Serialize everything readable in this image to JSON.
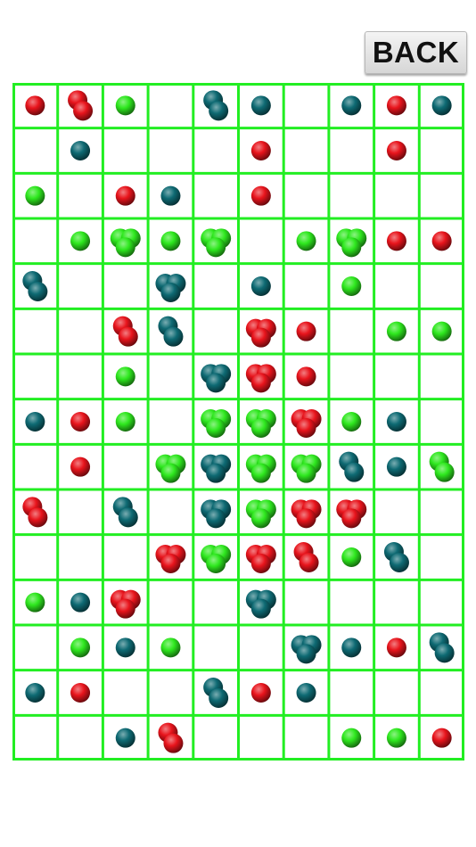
{
  "header": {
    "back_label": "BACK"
  },
  "colors": {
    "grid_line": "#22ee22",
    "red": "#e8141c",
    "green": "#2ee81e",
    "teal": "#0e6a73"
  },
  "board": {
    "rows": 15,
    "cols": 10,
    "cells": [
      [
        {
          "c": "red",
          "n": 1
        },
        {
          "c": "red",
          "n": 2
        },
        {
          "c": "green",
          "n": 1
        },
        null,
        {
          "c": "teal",
          "n": 2
        },
        {
          "c": "teal",
          "n": 1
        },
        null,
        {
          "c": "teal",
          "n": 1
        },
        {
          "c": "red",
          "n": 1
        },
        {
          "c": "teal",
          "n": 1
        }
      ],
      [
        null,
        {
          "c": "teal",
          "n": 1
        },
        null,
        null,
        null,
        {
          "c": "red",
          "n": 1
        },
        null,
        null,
        {
          "c": "red",
          "n": 1
        },
        null
      ],
      [
        {
          "c": "green",
          "n": 1
        },
        null,
        {
          "c": "red",
          "n": 1
        },
        {
          "c": "teal",
          "n": 1
        },
        null,
        {
          "c": "red",
          "n": 1
        },
        null,
        null,
        null,
        null
      ],
      [
        null,
        {
          "c": "green",
          "n": 1
        },
        {
          "c": "green",
          "n": 3
        },
        {
          "c": "green",
          "n": 1
        },
        {
          "c": "green",
          "n": 3
        },
        null,
        {
          "c": "green",
          "n": 1
        },
        {
          "c": "green",
          "n": 3
        },
        {
          "c": "red",
          "n": 1
        },
        {
          "c": "red",
          "n": 1
        }
      ],
      [
        {
          "c": "teal",
          "n": 2
        },
        null,
        null,
        {
          "c": "teal",
          "n": 3
        },
        null,
        {
          "c": "teal",
          "n": 1
        },
        null,
        {
          "c": "green",
          "n": 1
        },
        null,
        null
      ],
      [
        null,
        null,
        {
          "c": "red",
          "n": 2
        },
        {
          "c": "teal",
          "n": 2
        },
        null,
        {
          "c": "red",
          "n": 3
        },
        {
          "c": "red",
          "n": 1
        },
        null,
        {
          "c": "green",
          "n": 1
        },
        {
          "c": "green",
          "n": 1
        }
      ],
      [
        null,
        null,
        {
          "c": "green",
          "n": 1
        },
        null,
        {
          "c": "teal",
          "n": 3
        },
        {
          "c": "red",
          "n": 3
        },
        {
          "c": "red",
          "n": 1
        },
        null,
        null,
        null
      ],
      [
        {
          "c": "teal",
          "n": 1
        },
        {
          "c": "red",
          "n": 1
        },
        {
          "c": "green",
          "n": 1
        },
        null,
        {
          "c": "green",
          "n": 3
        },
        {
          "c": "green",
          "n": 3
        },
        {
          "c": "red",
          "n": 3
        },
        {
          "c": "green",
          "n": 1
        },
        {
          "c": "teal",
          "n": 1
        },
        null
      ],
      [
        null,
        {
          "c": "red",
          "n": 1
        },
        null,
        {
          "c": "green",
          "n": 3
        },
        {
          "c": "teal",
          "n": 3
        },
        {
          "c": "green",
          "n": 3
        },
        {
          "c": "green",
          "n": 3
        },
        {
          "c": "teal",
          "n": 2
        },
        {
          "c": "teal",
          "n": 1
        },
        {
          "c": "green",
          "n": 2
        }
      ],
      [
        {
          "c": "red",
          "n": 2
        },
        null,
        {
          "c": "teal",
          "n": 2
        },
        null,
        {
          "c": "teal",
          "n": 3
        },
        {
          "c": "green",
          "n": 3
        },
        {
          "c": "red",
          "n": 3
        },
        {
          "c": "red",
          "n": 3
        },
        null,
        null
      ],
      [
        null,
        null,
        null,
        {
          "c": "red",
          "n": 3
        },
        {
          "c": "green",
          "n": 3
        },
        {
          "c": "red",
          "n": 3
        },
        {
          "c": "red",
          "n": 2
        },
        {
          "c": "green",
          "n": 1
        },
        {
          "c": "teal",
          "n": 2
        },
        null
      ],
      [
        {
          "c": "green",
          "n": 1
        },
        {
          "c": "teal",
          "n": 1
        },
        {
          "c": "red",
          "n": 3
        },
        null,
        null,
        {
          "c": "teal",
          "n": 3
        },
        null,
        null,
        null,
        null
      ],
      [
        null,
        {
          "c": "green",
          "n": 1
        },
        {
          "c": "teal",
          "n": 1
        },
        {
          "c": "green",
          "n": 1
        },
        null,
        null,
        {
          "c": "teal",
          "n": 3
        },
        {
          "c": "teal",
          "n": 1
        },
        {
          "c": "red",
          "n": 1
        },
        {
          "c": "teal",
          "n": 2
        }
      ],
      [
        {
          "c": "teal",
          "n": 1
        },
        {
          "c": "red",
          "n": 1
        },
        null,
        null,
        {
          "c": "teal",
          "n": 2
        },
        {
          "c": "red",
          "n": 1
        },
        {
          "c": "teal",
          "n": 1
        },
        null,
        null,
        null
      ],
      [
        null,
        null,
        {
          "c": "teal",
          "n": 1
        },
        {
          "c": "red",
          "n": 2
        },
        null,
        null,
        null,
        {
          "c": "green",
          "n": 1
        },
        {
          "c": "green",
          "n": 1
        },
        {
          "c": "red",
          "n": 1
        }
      ]
    ]
  }
}
